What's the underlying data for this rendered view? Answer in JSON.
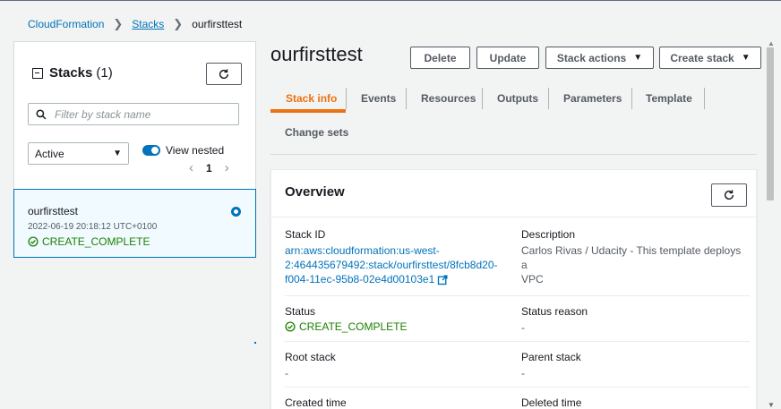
{
  "breadcrumb": {
    "items": [
      "CloudFormation",
      "Stacks",
      "ourfirsttest"
    ]
  },
  "left": {
    "title": "Stacks",
    "count": "(1)",
    "filter_placeholder": "Filter by stack name",
    "status_filter": "Active",
    "view_nested_label": "View nested",
    "page": "1",
    "stacks": [
      {
        "name": "ourfirsttest",
        "date": "2022-06-19 20:18:12 UTC+0100",
        "status": "CREATE_COMPLETE"
      }
    ]
  },
  "main": {
    "title": "ourfirsttest",
    "buttons": {
      "delete": "Delete",
      "update": "Update",
      "stack_actions": "Stack actions",
      "create_stack": "Create stack"
    },
    "tabs": [
      "Stack info",
      "Events",
      "Resources",
      "Outputs",
      "Parameters",
      "Template",
      "Change sets"
    ],
    "active_tab": "Stack info"
  },
  "overview": {
    "title": "Overview",
    "stack_id_label": "Stack ID",
    "stack_id_lines": [
      "arn:aws:cloudformation:us-west-",
      "2:464435679492:stack/ourfirsttest/8fcb8d20-",
      "f004-11ec-95b8-02e4d00103e1"
    ],
    "description_label": "Description",
    "description_lines": [
      "Carlos Rivas / Udacity - This template deploys a",
      "VPC"
    ],
    "status_label": "Status",
    "status_value": "CREATE_COMPLETE",
    "status_reason_label": "Status reason",
    "status_reason_value": "-",
    "root_stack_label": "Root stack",
    "root_stack_value": "-",
    "parent_stack_label": "Parent stack",
    "parent_stack_value": "-",
    "created_time_label": "Created time",
    "deleted_time_label": "Deleted time"
  },
  "colors": {
    "link": "#0073bb",
    "accent_orange": "#ec7211",
    "success_green": "#1d8102",
    "selected_bg": "#f1faff"
  },
  "icons": [
    "chevron-right-icon",
    "collapse-icon",
    "refresh-icon",
    "search-icon",
    "caret-down-icon",
    "toggle-icon",
    "radio-selected-icon",
    "success-check-icon",
    "external-link-icon"
  ]
}
